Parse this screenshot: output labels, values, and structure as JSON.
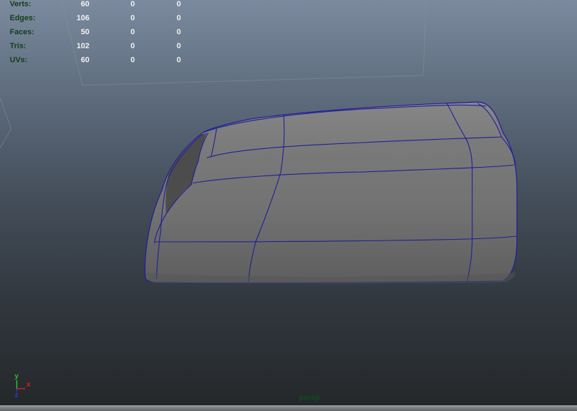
{
  "hud": {
    "rows": [
      {
        "label": "Verts:",
        "v1": "60",
        "v2": "0",
        "v3": "0"
      },
      {
        "label": "Edges:",
        "v1": "106",
        "v2": "0",
        "v3": "0"
      },
      {
        "label": "Faces:",
        "v1": "50",
        "v2": "0",
        "v3": "0"
      },
      {
        "label": "Tris:",
        "v1": "102",
        "v2": "0",
        "v3": "0"
      },
      {
        "label": "UVs:",
        "v1": "60",
        "v2": "0",
        "v3": "0"
      }
    ]
  },
  "axis": {
    "y": "y",
    "x": "x",
    "z": "z"
  },
  "camera": {
    "label": "persp"
  },
  "colors": {
    "wireframe": "#1e1e9a",
    "mesh_fill": "#7a7a7a",
    "x_axis": "#d82020",
    "y_axis": "#30c030",
    "z_axis": "#2040e0"
  }
}
